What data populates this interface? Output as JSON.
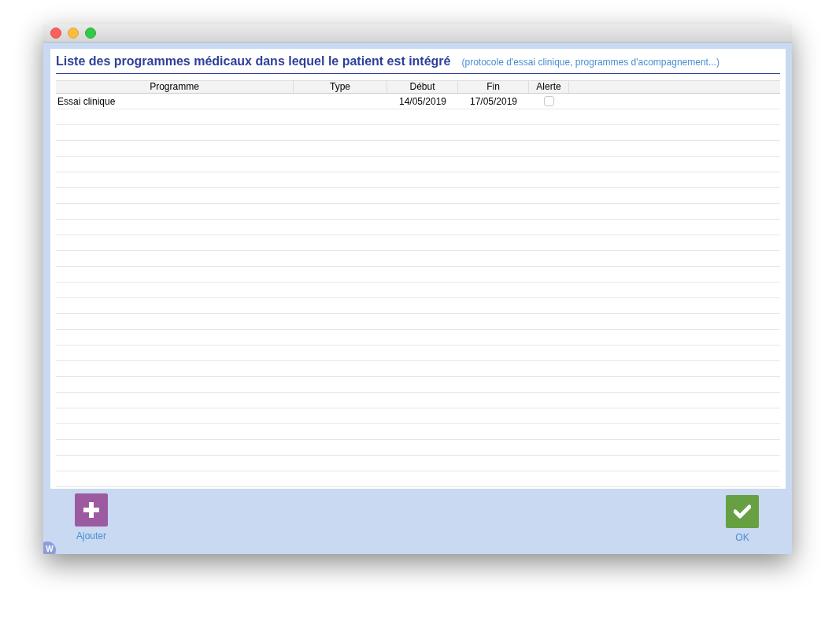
{
  "header": {
    "title": "Liste des programmes médicaux dans lequel le patient est intégré",
    "subtitle": "(protocole d'essai clinique, programmes d'acompagnement...)"
  },
  "table": {
    "columns": [
      "Programme",
      "Type",
      "Début",
      "Fin",
      "Alerte"
    ],
    "rows": [
      {
        "programme": "Essai clinique",
        "debut": "14/05/2019",
        "fin": "17/05/2019",
        "alerte": false
      }
    ]
  },
  "buttons": [
    {
      "kind": "add",
      "label": "Ajouter"
    },
    {
      "kind": "ok",
      "label": "OK"
    }
  ],
  "badge": "W"
}
